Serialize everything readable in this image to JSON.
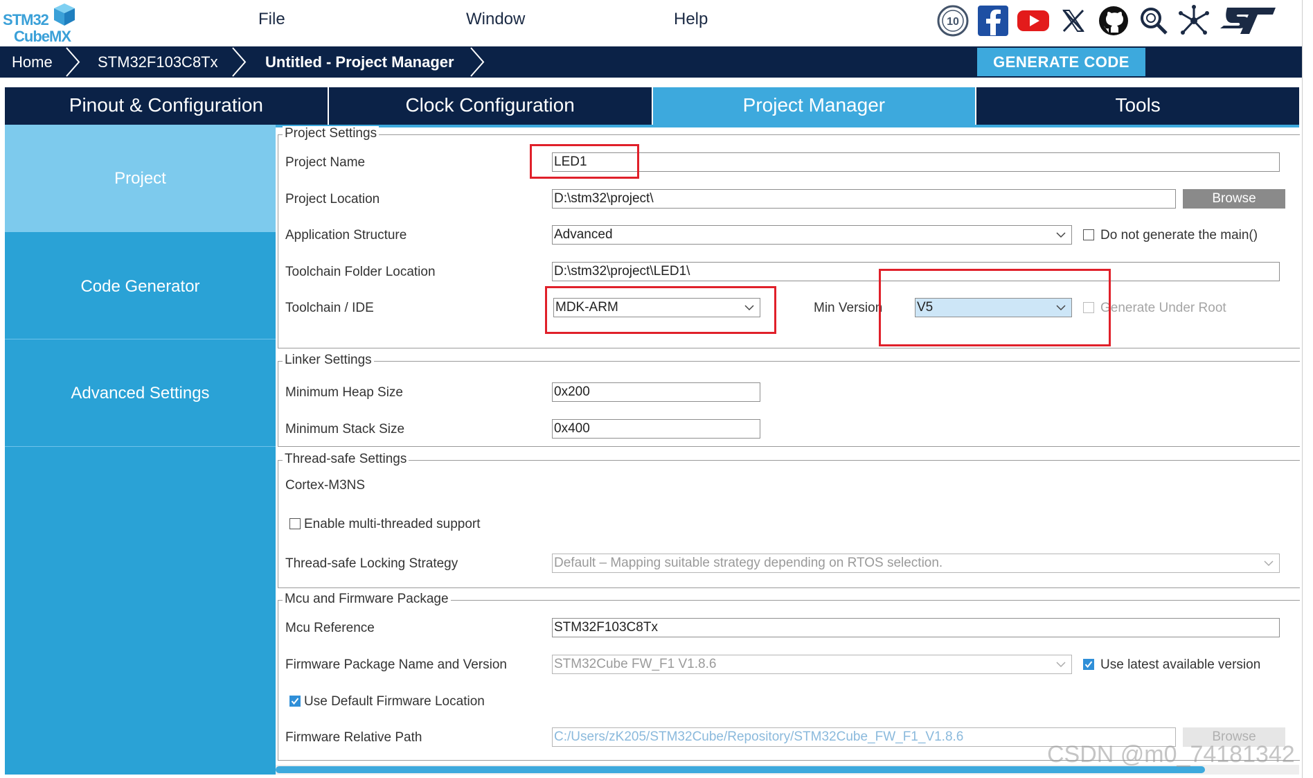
{
  "app": {
    "logo_stm": "STM32",
    "logo_cube": "CubeMX"
  },
  "menu": {
    "file": "File",
    "window": "Window",
    "help": "Help"
  },
  "social_icons": [
    "anniversary-10-icon",
    "facebook-icon",
    "youtube-icon",
    "x-twitter-icon",
    "github-icon",
    "search-community-icon",
    "network-icon",
    "st-logo-icon"
  ],
  "breadcrumb": {
    "home": "Home",
    "mcu": "STM32F103C8Tx",
    "current": "Untitled - Project Manager"
  },
  "generate_button": "GENERATE CODE",
  "tabs": [
    "Pinout & Configuration",
    "Clock Configuration",
    "Project Manager",
    "Tools"
  ],
  "active_tab": "Project Manager",
  "sidebar": {
    "items": [
      "Project",
      "Code Generator",
      "Advanced Settings"
    ],
    "active": "Project"
  },
  "project_settings": {
    "title": "Project Settings",
    "project_name_label": "Project Name",
    "project_name": "LED1",
    "project_location_label": "Project Location",
    "project_location": "D:\\stm32\\project\\",
    "browse": "Browse",
    "app_structure_label": "Application Structure",
    "app_structure": "Advanced",
    "no_main_label": "Do not generate the main()",
    "toolchain_folder_label": "Toolchain Folder Location",
    "toolchain_folder": "D:\\stm32\\project\\LED1\\",
    "toolchain_ide_label": "Toolchain / IDE",
    "toolchain_ide": "MDK-ARM",
    "min_version_label": "Min Version",
    "min_version": "V5",
    "generate_under_root_label": "Generate Under Root"
  },
  "linker_settings": {
    "title": "Linker Settings",
    "heap_label": "Minimum Heap Size",
    "heap": "0x200",
    "stack_label": "Minimum Stack Size",
    "stack": "0x400"
  },
  "thread_safe": {
    "title": "Thread-safe Settings",
    "core": "Cortex-M3NS",
    "multithread_label": "Enable multi-threaded support",
    "locking_label": "Thread-safe Locking Strategy",
    "locking": "Default – Mapping suitable strategy depending on RTOS selection."
  },
  "mcu_firmware": {
    "title": "Mcu and Firmware Package",
    "mcu_ref_label": "Mcu Reference",
    "mcu_ref": "STM32F103C8Tx",
    "fw_label": "Firmware Package Name and Version",
    "fw": "STM32Cube FW_F1 V1.8.6",
    "use_latest_label": "Use latest available version",
    "use_default_label": "Use Default Firmware Location",
    "fw_path_label": "Firmware Relative Path",
    "fw_path": "C:/Users/zK205/STM32Cube/Repository/STM32Cube_FW_F1_V1.8.6",
    "browse": "Browse"
  },
  "watermark": "CSDN @m0_74181342",
  "colors": {
    "navy": "#0b2247",
    "accent": "#3da9dd",
    "sidebar": "#2aa2d6",
    "sidebar_active": "#7dcaed",
    "highlight_red": "#e0202a"
  }
}
